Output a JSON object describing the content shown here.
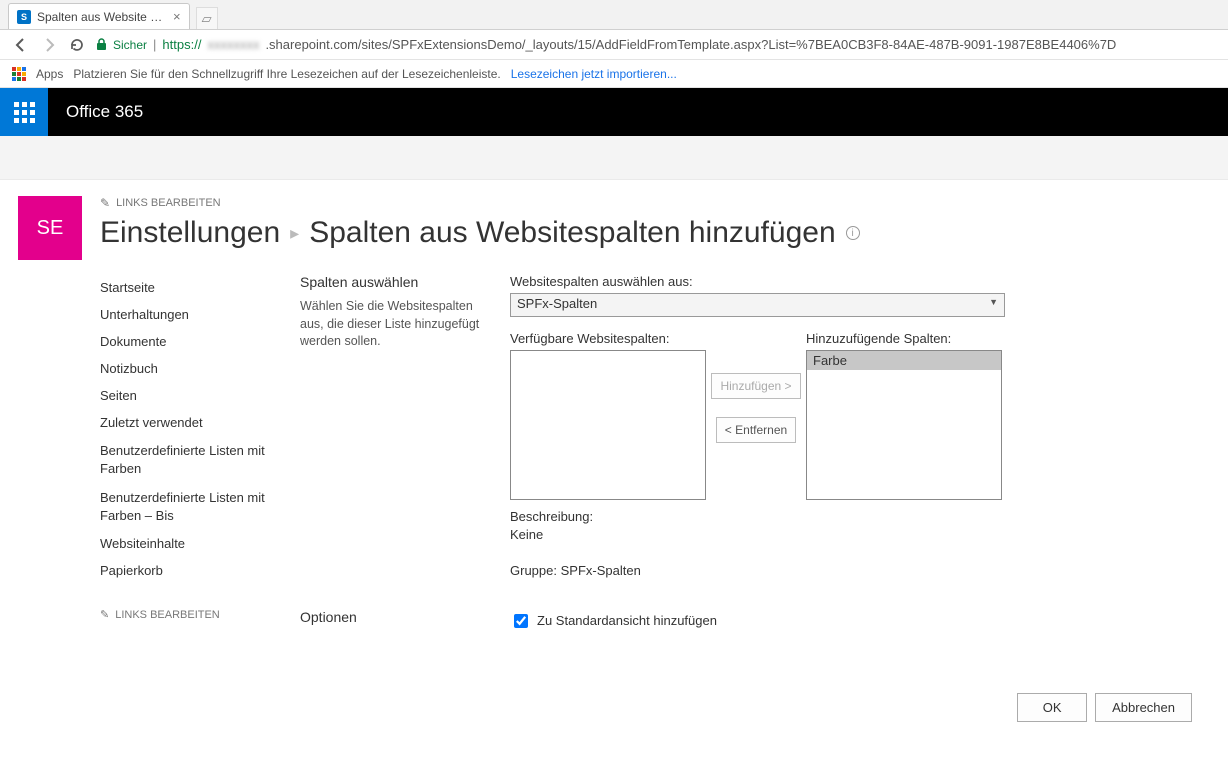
{
  "browser": {
    "tab_title": "Spalten aus Website C hi",
    "secure_label": "Sicher",
    "url_proto": "https://",
    "url_blur": "xxxxxxxx",
    "url_rest": ".sharepoint.com/sites/SPFxExtensionsDemo/_layouts/15/AddFieldFromTemplate.aspx?List=%7BEA0CB3F8-84AE-487B-9091-1987E8BE4406%7D",
    "apps_label": "Apps",
    "bookmark_hint": "Platzieren Sie für den Schnellzugriff Ihre Lesezeichen auf der Lesezeichenleiste.",
    "bookmark_link": "Lesezeichen jetzt importieren..."
  },
  "suite": {
    "brand": "Office 365"
  },
  "site": {
    "logo_text": "SE",
    "edit_links": "LINKS BEARBEITEN"
  },
  "title": {
    "main": "Einstellungen",
    "sub": "Spalten aus Websitespalten hinzufügen"
  },
  "nav": {
    "items": [
      "Startseite",
      "Unterhaltungen",
      "Dokumente",
      "Notizbuch",
      "Seiten",
      "Zuletzt verwendet",
      "Benutzerdefinierte Listen mit Farben",
      "Benutzerdefinierte Listen mit Farben – Bis",
      "Websiteinhalte",
      "Papierkorb"
    ],
    "edit_links": "LINKS BEARBEITEN"
  },
  "section1": {
    "heading": "Spalten auswählen",
    "desc": "Wählen Sie die Websitespalten aus, die dieser Liste hinzugefügt werden sollen."
  },
  "form": {
    "group_label": "Websitespalten auswählen aus:",
    "group_value": "SPFx-Spalten",
    "avail_label": "Verfügbare Websitespalten:",
    "sel_label": "Hinzuzufügende Spalten:",
    "sel_items": [
      "Farbe"
    ],
    "add_btn": "Hinzufügen >",
    "remove_btn": "< Entfernen",
    "desc_label": "Beschreibung:",
    "desc_value": "Keine",
    "group_line_label": "Gruppe:",
    "group_line_value": "SPFx-Spalten"
  },
  "section2": {
    "heading": "Optionen",
    "checkbox_label": "Zu Standardansicht hinzufügen"
  },
  "footer": {
    "ok": "OK",
    "cancel": "Abbrechen"
  }
}
